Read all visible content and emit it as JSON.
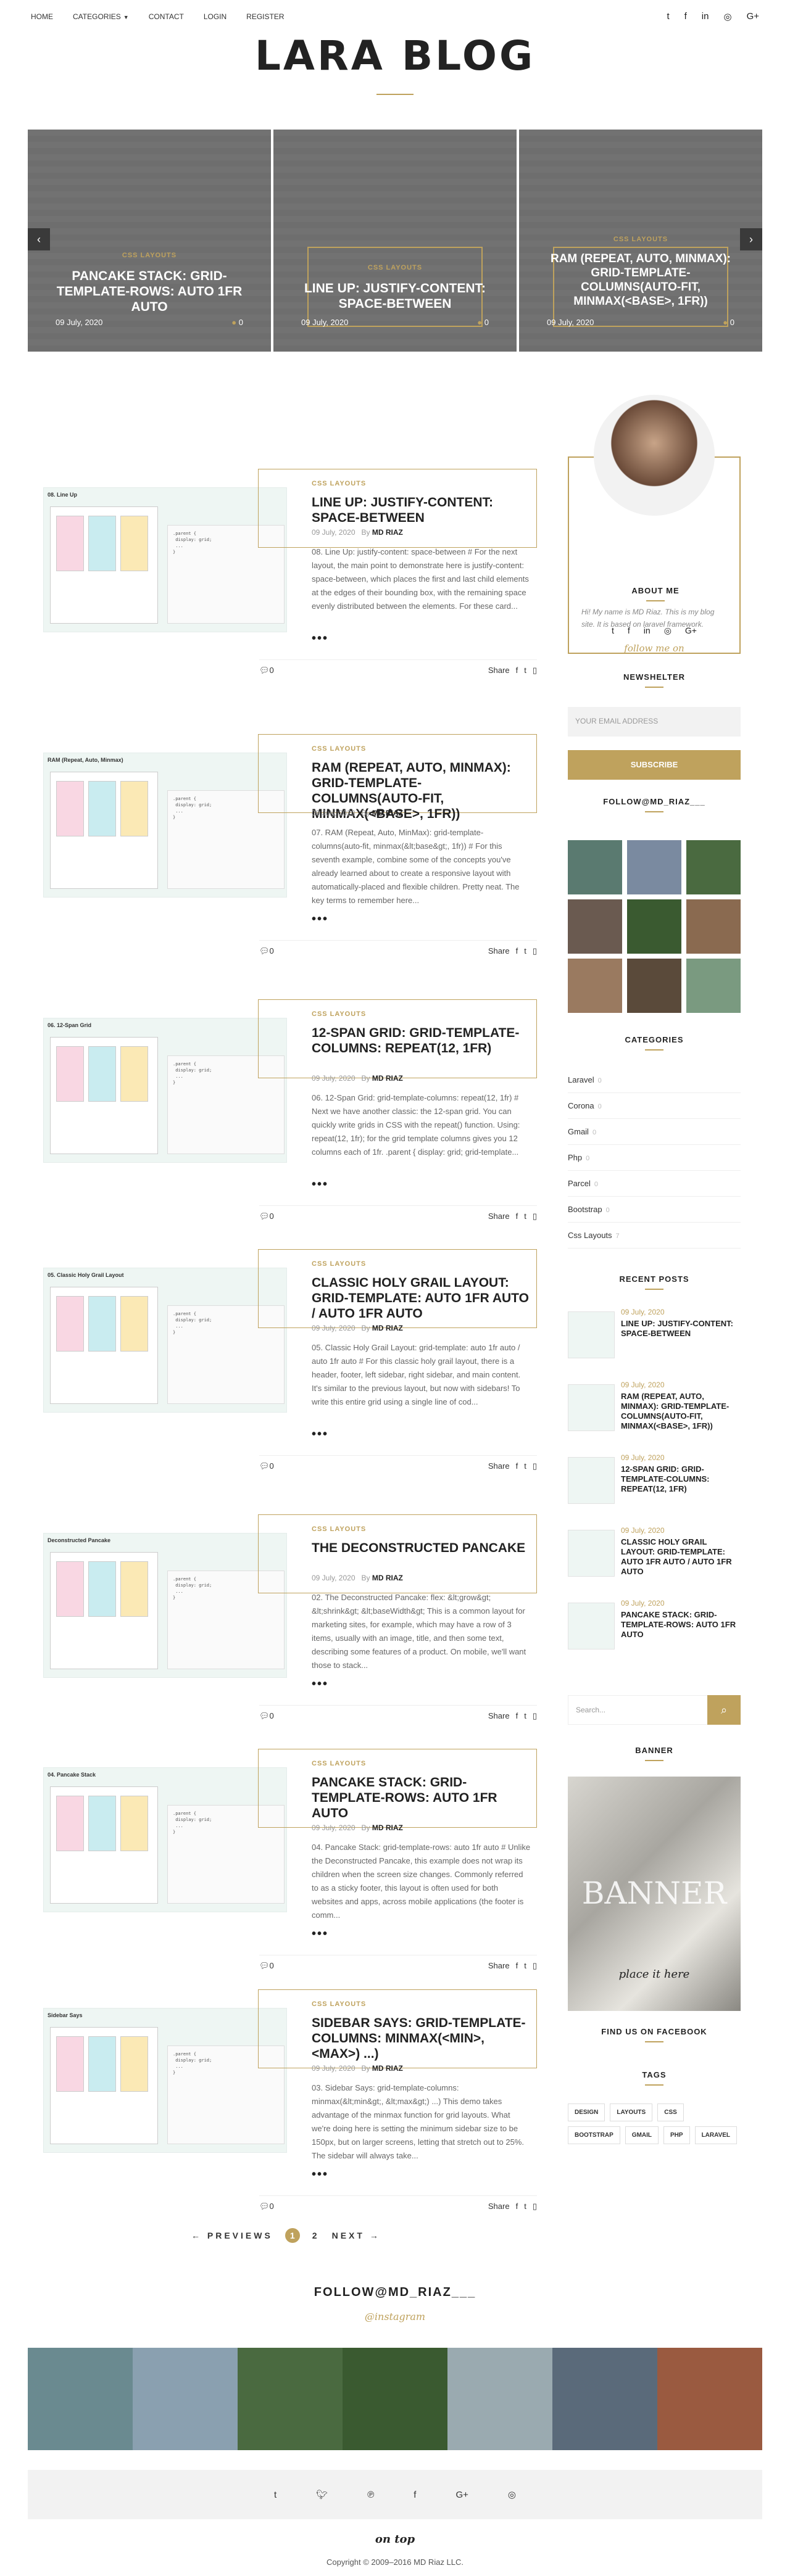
{
  "nav": {
    "items": [
      "HOME",
      "CATEGORIES",
      "CONTACT",
      "LOGIN",
      "REGISTER"
    ],
    "social": [
      "twitter-icon",
      "facebook-icon",
      "linkedin-icon",
      "instagram-icon",
      "google-plus-icon"
    ]
  },
  "site_title": "LARA BLOG",
  "slider": {
    "slides": [
      {
        "cat": "CSS LAYOUTS",
        "title": "PANCAKE STACK: GRID-TEMPLATE-ROWS: AUTO 1FR AUTO",
        "date": "09 July, 2020",
        "comments": "0"
      },
      {
        "cat": "CSS LAYOUTS",
        "title": "LINE UP: JUSTIFY-CONTENT: SPACE-BETWEEN",
        "date": "09 July, 2020",
        "comments": "0"
      },
      {
        "cat": "CSS LAYOUTS",
        "title": "RAM (REPEAT, AUTO, MINMAX): GRID-TEMPLATE-COLUMNS(AUTO-FIT, MINMAX(<BASE>, 1FR))",
        "date": "09 July, 2020",
        "comments": "0"
      }
    ],
    "prev": "‹",
    "next": "›"
  },
  "posts": [
    {
      "cat": "CSS LAYOUTS",
      "title": "LINE UP: JUSTIFY-CONTENT: SPACE-BETWEEN",
      "date": "09 July, 2020",
      "by": "By",
      "author": "MD RIAZ",
      "excerpt": "08. Line Up: justify-content: space-between # For the next layout, the main point to demonstrate here is justify-content: space-between, which places the first and last child elements at the edges of their bounding box, with the remaining space evenly distributed between the elements. For these card...",
      "comments": "0",
      "thumb_label": "08. Line Up"
    },
    {
      "cat": "CSS LAYOUTS",
      "title": "RAM (REPEAT, AUTO, MINMAX): GRID-TEMPLATE-COLUMNS(AUTO-FIT, MINMAX(<BASE>, 1FR))",
      "date": "09 July, 2020",
      "by": "By",
      "author": "MD RIAZ",
      "excerpt": "07. RAM (Repeat, Auto, MinMax): grid-template-columns(auto-fit, minmax(&lt;base&gt;, 1fr)) # For this seventh example, combine some of the concepts you've already learned about to create a responsive layout with automatically-placed and flexible children. Pretty neat. The key terms to remember here...",
      "comments": "0",
      "thumb_label": "RAM (Repeat, Auto, Minmax)"
    },
    {
      "cat": "CSS LAYOUTS",
      "title": "12-SPAN GRID: GRID-TEMPLATE-COLUMNS: REPEAT(12, 1FR)",
      "date": "09 July, 2020",
      "by": "By",
      "author": "MD RIAZ",
      "excerpt": "06. 12-Span Grid: grid-template-columns: repeat(12, 1fr) # Next we have another classic: the 12-span grid. You can quickly write grids in CSS with the repeat() function. Using: repeat(12, 1fr); for the grid template columns gives you 12 columns each of 1fr. .parent { display: grid; grid-template...",
      "comments": "0",
      "thumb_label": "06. 12-Span Grid"
    },
    {
      "cat": "CSS LAYOUTS",
      "title": "CLASSIC HOLY GRAIL LAYOUT: GRID-TEMPLATE: AUTO 1FR AUTO / AUTO 1FR AUTO",
      "date": "09 July, 2020",
      "by": "By",
      "author": "MD RIAZ",
      "excerpt": "05. Classic Holy Grail Layout: grid-template: auto 1fr auto / auto 1fr auto # For this classic holy grail layout, there is a header, footer, left sidebar, right sidebar, and main content. It's similar to the previous layout, but now with sidebars! To write this entire grid using a single line of cod...",
      "comments": "0",
      "thumb_label": "05. Classic Holy Grail Layout"
    },
    {
      "cat": "CSS LAYOUTS",
      "title": "THE DECONSTRUCTED PANCAKE",
      "date": "09 July, 2020",
      "by": "By",
      "author": "MD RIAZ",
      "excerpt": "02. The Deconstructed Pancake: flex: &lt;grow&gt; &lt;shrink&gt; &lt;baseWidth&gt; This is a common layout for marketing sites, for example, which may have a row of 3 items, usually with an image, title, and then some text, describing some features of a product. On mobile, we'll want those to stack...",
      "comments": "0",
      "thumb_label": "Deconstructed Pancake"
    },
    {
      "cat": "CSS LAYOUTS",
      "title": "PANCAKE STACK: GRID-TEMPLATE-ROWS: AUTO 1FR AUTO",
      "date": "09 July, 2020",
      "by": "By",
      "author": "MD RIAZ",
      "excerpt": "04. Pancake Stack: grid-template-rows: auto 1fr auto # Unlike the Deconstructed Pancake, this example does not wrap its children when the screen size changes. Commonly referred to as a sticky footer, this layout is often used for both websites and apps, across mobile applications (the footer is comm...",
      "comments": "0",
      "thumb_label": "04. Pancake Stack"
    },
    {
      "cat": "CSS LAYOUTS",
      "title": "SIDEBAR SAYS: GRID-TEMPLATE-COLUMNS: MINMAX(<MIN>, <MAX>) ...)",
      "date": "09 July, 2020",
      "by": "By",
      "author": "MD RIAZ",
      "excerpt": "03. Sidebar Says: grid-template-columns: minmax(&lt;min&gt;, &lt;max&gt;) ...) This demo takes advantage of the minmax function for grid layouts. What we're doing here is setting the minimum sidebar size to be 150px, but on larger screens, letting that stretch out to 25%. The sidebar will always take...",
      "comments": "0",
      "thumb_label": "Sidebar Says"
    }
  ],
  "dots": "•••",
  "share_label": "Share",
  "pager": {
    "prev": "← PREVIEWS",
    "pages": [
      "1",
      "2"
    ],
    "next": "NEXT →"
  },
  "sidebar": {
    "about_title": "ABOUT ME",
    "about_text": "Hi! My name is MD Riaz. This is my blog site. It is based on laravel framework.",
    "signature": "follow me on",
    "newsletter_title": "NEWSHELTER",
    "email_placeholder": "YOUR EMAIL ADDRESS",
    "subscribe": "SUBSCRIBE",
    "follow_title": "FOLLOW@MD_RIAZ___",
    "categories_title": "CATEGORIES",
    "categories": [
      {
        "name": "Laravel",
        "count": "0"
      },
      {
        "name": "Corona",
        "count": "0"
      },
      {
        "name": "Gmail",
        "count": "0"
      },
      {
        "name": "Php",
        "count": "0"
      },
      {
        "name": "Parcel",
        "count": "0"
      },
      {
        "name": "Bootstrap",
        "count": "0"
      },
      {
        "name": "Css Layouts",
        "count": "7"
      }
    ],
    "recent_title": "RECENT POSTS",
    "recent": [
      {
        "date": "09 July, 2020",
        "title": "LINE UP: JUSTIFY-CONTENT: SPACE-BETWEEN"
      },
      {
        "date": "09 July, 2020",
        "title": "RAM (REPEAT, AUTO, MINMAX): GRID-TEMPLATE-COLUMNS(AUTO-FIT, MINMAX(<BASE>, 1FR))"
      },
      {
        "date": "09 July, 2020",
        "title": "12-SPAN GRID: GRID-TEMPLATE-COLUMNS: REPEAT(12, 1FR)"
      },
      {
        "date": "09 July, 2020",
        "title": "CLASSIC HOLY GRAIL LAYOUT: GRID-TEMPLATE: AUTO 1FR AUTO / AUTO 1FR AUTO"
      },
      {
        "date": "09 July, 2020",
        "title": "PANCAKE STACK: GRID-TEMPLATE-ROWS: AUTO 1FR AUTO"
      }
    ],
    "search_placeholder": "Search...",
    "banner_title": "BANNER",
    "banner_text": "BANNER",
    "banner_sub": "place it here",
    "facebook_title": "FIND US ON FACEBOOK",
    "tags_title": "TAGS",
    "tags": [
      "DESIGN",
      "LAYOUTS",
      "CSS",
      "BOOTSTRAP",
      "GMAIL",
      "PHP",
      "LARAVEL"
    ]
  },
  "instagram": {
    "title": "FOLLOW@MD_RIAZ___",
    "subtitle": "@instagram"
  },
  "footer": {
    "on_top": "on top",
    "copyright": "Copyright © 2009–2016 MD Riaz LLC."
  },
  "colors": {
    "accent": "#bfa25d"
  }
}
